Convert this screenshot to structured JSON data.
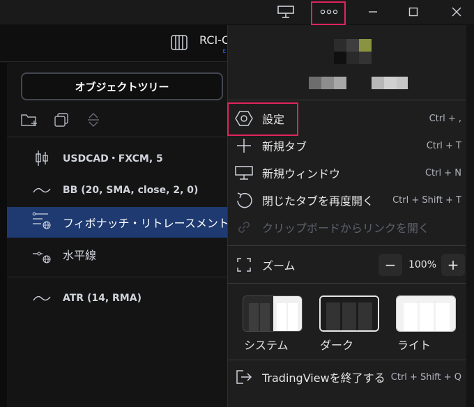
{
  "chart": {
    "title": "RCI-C",
    "subtitle": "ε"
  },
  "object_tree": {
    "tab_label": "オブジェクトツリー",
    "items": [
      {
        "label": "USDCAD・FXCM, 5",
        "icon": "candlestick-icon"
      },
      {
        "label": "BB (20, SMA, close, 2, 0)",
        "icon": "wave-icon"
      },
      {
        "label": "フィボナッチ・リトレースメント",
        "icon": "fib-retracement-icon",
        "selected": true
      },
      {
        "label": "水平線",
        "icon": "horizontal-line-icon"
      },
      {
        "label": "ATR (14, RMA)",
        "icon": "wave-icon"
      }
    ]
  },
  "menu": {
    "items": [
      {
        "label": "設定",
        "shortcut": "Ctrl + ,",
        "icon": "gear-hexagon-icon"
      },
      {
        "label": "新規タブ",
        "shortcut": "Ctrl + T",
        "icon": "plus-icon"
      },
      {
        "label": "新規ウィンドウ",
        "shortcut": "Ctrl + N",
        "icon": "monitor-icon"
      },
      {
        "label": "閉じたタブを再度開く",
        "shortcut": "Ctrl + Shift + T",
        "icon": "reopen-icon"
      },
      {
        "label": "クリップボードからリンクを開く",
        "shortcut": "",
        "icon": "link-icon",
        "disabled": true
      }
    ],
    "zoom": {
      "label": "ズーム",
      "value": "100%",
      "minus": "−",
      "plus": "+"
    },
    "themes": [
      {
        "label": "システム",
        "key": "system"
      },
      {
        "label": "ダーク",
        "key": "dark",
        "selected": true
      },
      {
        "label": "ライト",
        "key": "light"
      }
    ],
    "quit": {
      "label": "TradingViewを終了する",
      "shortcut": "Ctrl + Shift + Q"
    }
  },
  "colors": {
    "accent": "#2962ff",
    "highlight": "#e0245e",
    "selected_row": "#1e3a70",
    "menu_bg": "#1e1e1e"
  }
}
